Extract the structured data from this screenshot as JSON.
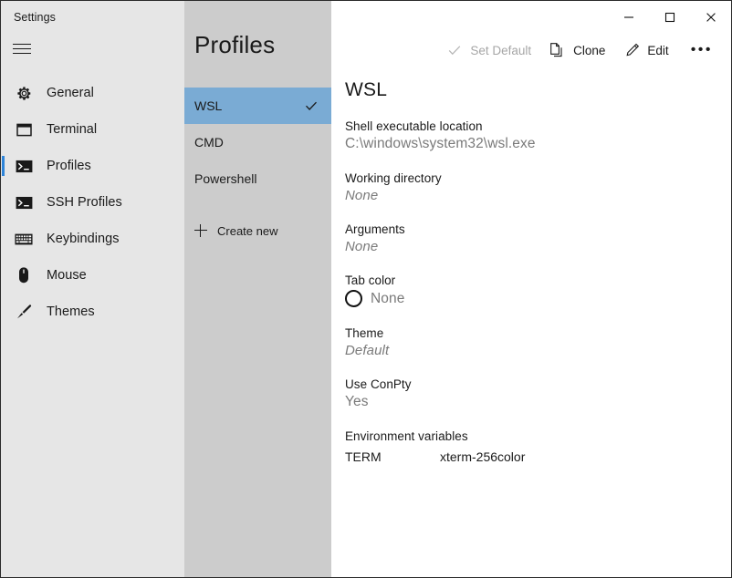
{
  "window": {
    "app_title": "Settings",
    "controls": {
      "minimize": "minimize",
      "maximize": "maximize",
      "close": "close"
    }
  },
  "sidebar": {
    "menu_icon": "hamburger-icon",
    "items": [
      {
        "label": "General",
        "icon": "gear-icon",
        "selected": false
      },
      {
        "label": "Terminal",
        "icon": "window-icon",
        "selected": false
      },
      {
        "label": "Profiles",
        "icon": "console-icon",
        "selected": true
      },
      {
        "label": "SSH Profiles",
        "icon": "console-icon",
        "selected": false
      },
      {
        "label": "Keybindings",
        "icon": "keyboard-icon",
        "selected": false
      },
      {
        "label": "Mouse",
        "icon": "mouse-icon",
        "selected": false
      },
      {
        "label": "Themes",
        "icon": "paintbrush-icon",
        "selected": false
      }
    ]
  },
  "profiles_panel": {
    "heading": "Profiles",
    "items": [
      {
        "name": "WSL",
        "selected": true
      },
      {
        "name": "CMD",
        "selected": false
      },
      {
        "name": "Powershell",
        "selected": false
      }
    ],
    "create_new_label": "Create new"
  },
  "toolbar": {
    "set_default_label": "Set Default",
    "set_default_disabled": true,
    "clone_label": "Clone",
    "edit_label": "Edit",
    "more_label": "•••"
  },
  "detail": {
    "title": "WSL",
    "fields": [
      {
        "label": "Shell executable location",
        "value": "C:\\windows\\system32\\wsl.exe",
        "style": "normal"
      },
      {
        "label": "Working directory",
        "value": "None",
        "style": "italic"
      },
      {
        "label": "Arguments",
        "value": "None",
        "style": "italic"
      },
      {
        "label": "Tab color",
        "value": "None",
        "style": "swatch"
      },
      {
        "label": "Theme",
        "value": "Default",
        "style": "italic"
      },
      {
        "label": "Use ConPty",
        "value": "Yes",
        "style": "normal"
      }
    ],
    "env_section_label": "Environment variables",
    "env_vars": [
      {
        "key": "TERM",
        "value": "xterm-256color"
      }
    ]
  },
  "colors": {
    "accent": "#2e84d8",
    "selection": "#7aabd4",
    "sidebar_bg": "#e6e6e6",
    "profiles_bg": "#cccccc",
    "main_bg": "#ffffff"
  }
}
